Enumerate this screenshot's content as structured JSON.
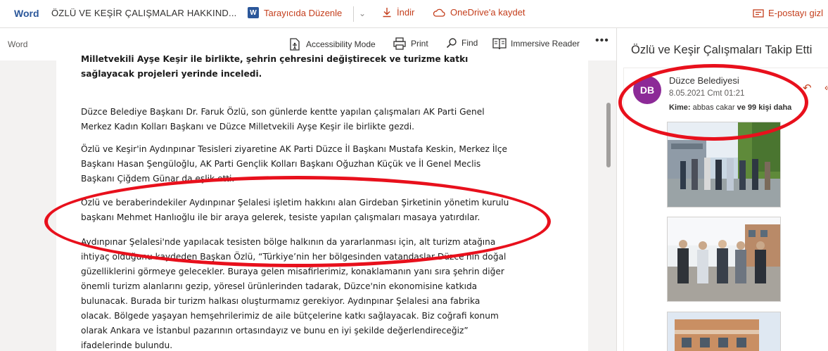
{
  "topbar": {
    "app_name": "Word",
    "doc_title": "ÖZLÜ VE KEŞİR ÇALIŞMALAR HAKKIND...",
    "edit_in_browser": "Tarayıcıda Düzenle",
    "download": "İndir",
    "save_onedrive": "OneDrive'a kaydet",
    "hide_email": "E-postayı gizl"
  },
  "toolbar": {
    "label": "Word",
    "accessibility": "Accessibility Mode",
    "print": "Print",
    "find": "Find",
    "immersive": "Immersive Reader",
    "more": "•••"
  },
  "document": {
    "p0": "Milletvekili Ayşe Keşir ile birlikte, şehrin çehresini değiştirecek ve turizme katkı sağlayacak projeleri yerinde inceledi.",
    "p1": "Düzce Belediye Başkanı Dr.  Faruk Özlü, son günlerde kentte yapılan çalışmaları  AK Parti Genel Merkez Kadın Kolları Başkanı ve Düzce Milletvekili Ayşe Keşir ile birlikte gezdi.",
    "p2": "Özlü ve Keşir'in Aydınpınar Tesisleri ziyaretine AK Parti Düzce İl Başkanı Mustafa Keskin, Merkez İlçe Başkanı Hasan Şengüloğlu, AK Parti Gençlik Kolları Başkanı Oğuzhan Küçük ve İl Genel Meclis Başkanı Çiğdem Günar da eşlik etti.",
    "p3": "Özlü ve beraberindekiler Aydınpınar Şelalesi işletim hakkını alan  Girdeban Şirketinin yönetim kurulu başkanı Mehmet Hanlıoğlu ile bir  araya gelerek, tesiste yapılan çalışmaları masaya yatırdılar.",
    "p4": "Aydınpınar Şelalesi'nde yapılacak tesisten bölge halkının da yararlanması için, alt  turizm atağına ihtiyaç olduğunu kaydeden Başkan Özlü, “Türkiye’nin her bölgesinden vatandaşlar Düzce'nin doğal güzelliklerini görmeye gelecekler. Buraya gelen misafirlerimiz, konaklamanın yanı sıra  şehrin diğer önemli turizm alanlarını gezip, yöresel ürünlerinden tadarak, Düzce'nin ekonomisine katkıda bulunacak. Burada bir turizm halkası oluşturmamız gerekiyor. Aydınpınar Şelalesi ana fabrika olacak.  Bölgede yaşayan hemşehrilerimiz de aile bütçelerine katkı sağlayacak. Biz coğrafi konum olarak Ankara ve İstanbul pazarının ortasındayız ve bunu en iyi şekilde değerlendireceğiz” ifadelerinde bulundu."
  },
  "panel": {
    "title": "Özlü ve Keşir Çalışmaları Takip Etti",
    "avatar": "DB",
    "sender": "Düzce Belediyesi",
    "date": "8.05.2021 Cmt 01:21",
    "to_label": "Kime:",
    "to_name": "abbas cakar",
    "to_more": "ve 99 kişi daha"
  },
  "colors": {
    "accent": "#c43e1c",
    "word_blue": "#2b579a",
    "avatar": "#8c2a97",
    "annotation": "#e8101c"
  }
}
